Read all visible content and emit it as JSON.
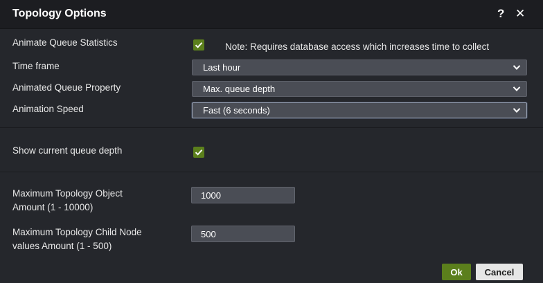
{
  "dialog": {
    "title": "Topology Options",
    "help_glyph": "?",
    "close_glyph": "✕"
  },
  "animation": {
    "animate_label": "Animate Queue Statistics",
    "animate_checked": true,
    "note": "Note: Requires database access which increases time to collect",
    "timeframe_label": "Time frame",
    "timeframe_value": "Last hour",
    "property_label": "Animated Queue Property",
    "property_value": "Max. queue depth",
    "speed_label": "Animation Speed",
    "speed_value": "Fast (6 seconds)"
  },
  "display": {
    "show_depth_label": "Show current queue depth",
    "show_depth_checked": true
  },
  "limits": {
    "max_objects_label_line1": "Maximum Topology Object",
    "max_objects_label_line2": "Amount (1 - 10000)",
    "max_objects_value": "1000",
    "max_child_label_line1": "Maximum Topology Child Node",
    "max_child_label_line2": "values Amount (1 - 500)",
    "max_child_value": "500"
  },
  "footer": {
    "ok_label": "Ok",
    "cancel_label": "Cancel"
  },
  "colors": {
    "accent_green": "#5b7f1c",
    "background": "#25272c",
    "titlebar": "#1c1d21"
  }
}
